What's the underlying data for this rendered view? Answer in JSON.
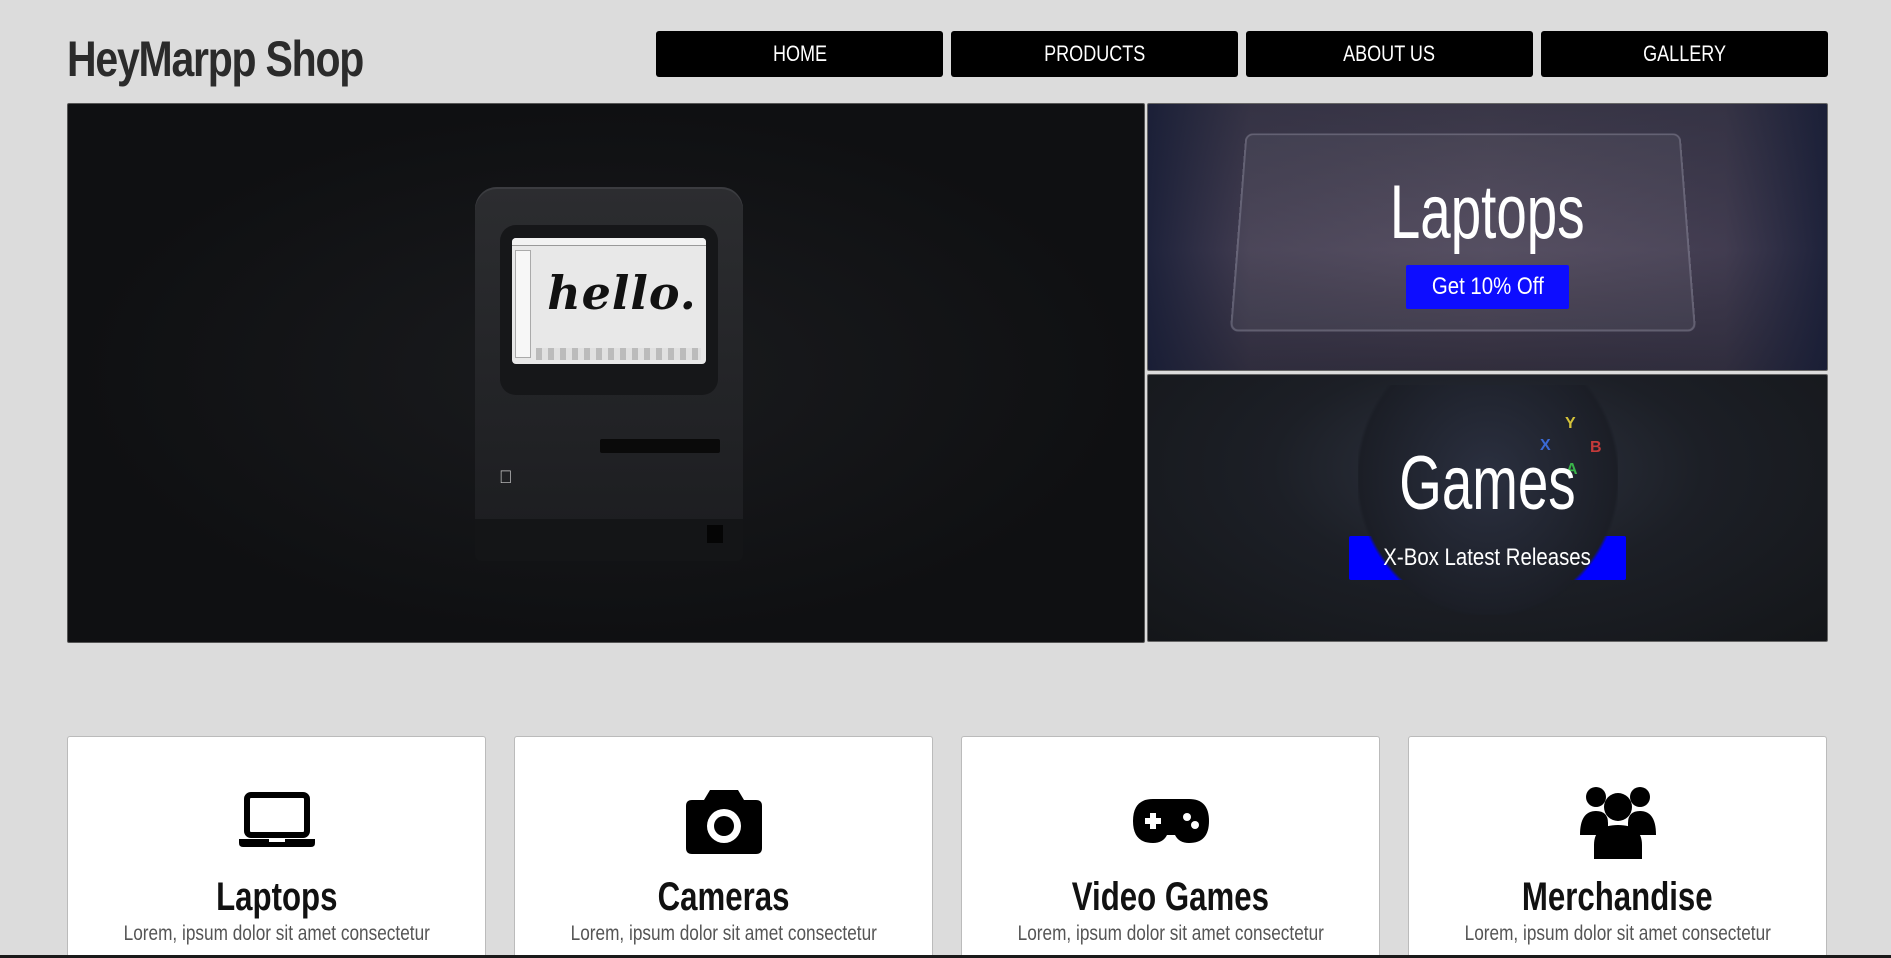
{
  "header": {
    "logo": "HeyMarpp Shop",
    "nav": [
      {
        "label": "HOME"
      },
      {
        "label": "PRODUCTS"
      },
      {
        "label": "ABOUT US"
      },
      {
        "label": "GALLERY"
      }
    ]
  },
  "hero": {
    "screen_text": "hello.",
    "promos": [
      {
        "title": "Laptops",
        "button": "Get 10% Off"
      },
      {
        "title": "Games",
        "button": "X-Box Latest Releases"
      }
    ]
  },
  "categories": [
    {
      "icon": "laptop-icon",
      "title": "Laptops",
      "text": "Lorem, ipsum dolor sit amet consectetur"
    },
    {
      "icon": "camera-icon",
      "title": "Cameras",
      "text": "Lorem, ipsum dolor sit amet consectetur"
    },
    {
      "icon": "gamepad-icon",
      "title": "Video Games",
      "text": "Lorem, ipsum dolor sit amet consectetur"
    },
    {
      "icon": "users-icon",
      "title": "Merchandise",
      "text": "Lorem, ipsum dolor sit amet consectetur"
    }
  ],
  "colors": {
    "background": "#dcdcdc",
    "nav_bg": "#000000",
    "promo_button": "#0000ff"
  }
}
